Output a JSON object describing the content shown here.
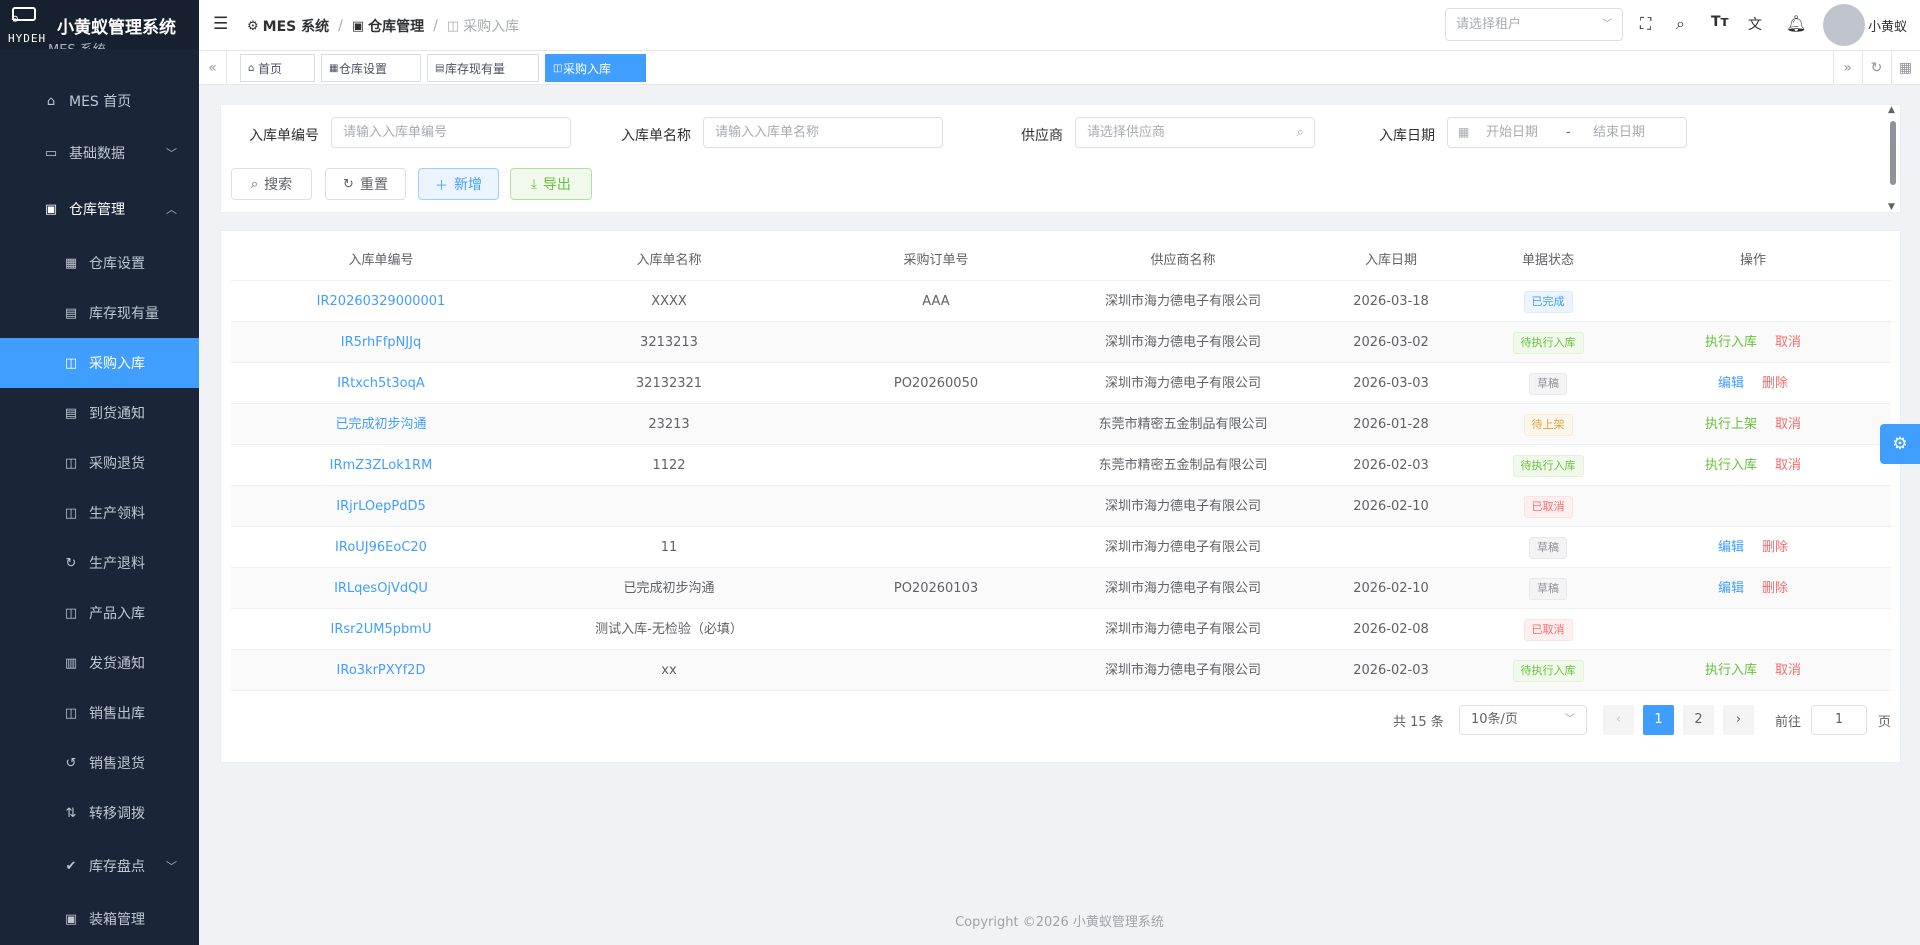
{
  "app": {
    "title": "小黄蚁管理系统",
    "logo_brand": "HYDEH",
    "logo_under": "MES 系统"
  },
  "sidebar": {
    "items": [
      {
        "label": "MES 首页",
        "icon": "home-icon"
      },
      {
        "label": "基础数据",
        "icon": "monitor-icon"
      },
      {
        "label": "仓库管理",
        "icon": "warehouse-icon"
      },
      {
        "label": "仓库设置",
        "icon": "building-icon"
      },
      {
        "label": "库存现有量",
        "icon": "document-icon"
      },
      {
        "label": "采购入库",
        "icon": "bag-icon"
      },
      {
        "label": "到货通知",
        "icon": "notice-icon"
      },
      {
        "label": "采购退货",
        "icon": "bag-icon"
      },
      {
        "label": "生产领料",
        "icon": "bag-icon"
      },
      {
        "label": "生产退料",
        "icon": "refresh-icon"
      },
      {
        "label": "产品入库",
        "icon": "bag-icon"
      },
      {
        "label": "发货通知",
        "icon": "truck-icon"
      },
      {
        "label": "销售出库",
        "icon": "bag-icon"
      },
      {
        "label": "销售退货",
        "icon": "refresh-icon"
      },
      {
        "label": "转移调拨",
        "icon": "transfer-icon"
      },
      {
        "label": "库存盘点",
        "icon": "check-circle-icon"
      },
      {
        "label": "装箱管理",
        "icon": "box-icon"
      }
    ]
  },
  "header": {
    "breadcrumb": [
      "MES 系统",
      "仓库管理",
      "采购入库"
    ],
    "tenant_placeholder": "请选择租户",
    "username": "小黄蚁"
  },
  "tabs": [
    {
      "label": "首页",
      "icon": "home-icon"
    },
    {
      "label": "仓库设置",
      "icon": "building-icon"
    },
    {
      "label": "库存现有量",
      "icon": "document-icon"
    },
    {
      "label": "采购入库",
      "icon": "bag-icon"
    }
  ],
  "search": {
    "fields": [
      {
        "label": "入库单编号",
        "placeholder": "请输入入库单编号"
      },
      {
        "label": "入库单名称",
        "placeholder": "请输入入库单名称"
      },
      {
        "label": "供应商",
        "placeholder": "请选择供应商"
      },
      {
        "label": "入库日期",
        "start": "开始日期",
        "end": "结束日期",
        "sep": "-"
      }
    ],
    "buttons": {
      "search": "搜索",
      "reset": "重置",
      "add": "新增",
      "export": "导出"
    }
  },
  "table": {
    "columns": [
      "入库单编号",
      "入库单名称",
      "采购订单号",
      "供应商名称",
      "入库日期",
      "单据状态",
      "操作"
    ],
    "rows": [
      {
        "code": "IR20260329000001",
        "name": "XXXX",
        "po": "AAA",
        "supplier": "深圳市海力德电子有限公司",
        "date": "2026-03-18",
        "status": "已完成",
        "status_color": "blue",
        "actions": []
      },
      {
        "code": "IR5rhFfpNJJq",
        "name": "3213213",
        "po": "",
        "supplier": "深圳市海力德电子有限公司",
        "date": "2026-03-02",
        "status": "待执行入库",
        "status_color": "green",
        "actions": [
          {
            "label": "执行入库",
            "color": "green"
          },
          {
            "label": "取消",
            "color": "red"
          }
        ]
      },
      {
        "code": "IRtxch5t3oqA",
        "name": "32132321",
        "po": "PO20260050",
        "supplier": "深圳市海力德电子有限公司",
        "date": "2026-03-03",
        "status": "草稿",
        "status_color": "gray",
        "actions": [
          {
            "label": "编辑",
            "color": "blue"
          },
          {
            "label": "删除",
            "color": "red"
          }
        ]
      },
      {
        "code": "已完成初步沟通",
        "name": "23213",
        "po": "",
        "supplier": "东莞市精密五金制品有限公司",
        "date": "2026-01-28",
        "status": "待上架",
        "status_color": "orange",
        "actions": [
          {
            "label": "执行上架",
            "color": "green"
          },
          {
            "label": "取消",
            "color": "red"
          }
        ]
      },
      {
        "code": "IRmZ3ZLok1RM",
        "name": "1122",
        "po": "",
        "supplier": "东莞市精密五金制品有限公司",
        "date": "2026-02-03",
        "status": "待执行入库",
        "status_color": "green",
        "actions": [
          {
            "label": "执行入库",
            "color": "green"
          },
          {
            "label": "取消",
            "color": "red"
          }
        ]
      },
      {
        "code": "IRjrLOepPdD5",
        "name": "",
        "po": "",
        "supplier": "深圳市海力德电子有限公司",
        "date": "2026-02-10",
        "status": "已取消",
        "status_color": "red",
        "actions": []
      },
      {
        "code": "IRoUJ96EoC20",
        "name": "11",
        "po": "",
        "supplier": "深圳市海力德电子有限公司",
        "date": "",
        "status": "草稿",
        "status_color": "gray",
        "actions": [
          {
            "label": "编辑",
            "color": "blue"
          },
          {
            "label": "删除",
            "color": "red"
          }
        ]
      },
      {
        "code": "IRLqesOjVdQU",
        "name": "已完成初步沟通",
        "po": "PO20260103",
        "supplier": "深圳市海力德电子有限公司",
        "date": "2026-02-10",
        "status": "草稿",
        "status_color": "gray",
        "actions": [
          {
            "label": "编辑",
            "color": "blue"
          },
          {
            "label": "删除",
            "color": "red"
          }
        ]
      },
      {
        "code": "IRsr2UM5pbmU",
        "name": "测试入库-无检验（必填）",
        "po": "",
        "supplier": "深圳市海力德电子有限公司",
        "date": "2026-02-08",
        "status": "已取消",
        "status_color": "red",
        "actions": []
      },
      {
        "code": "IRo3krPXYf2D",
        "name": "xx",
        "po": "",
        "supplier": "深圳市海力德电子有限公司",
        "date": "2026-02-03",
        "status": "待执行入库",
        "status_color": "green",
        "actions": [
          {
            "label": "执行入库",
            "color": "green"
          },
          {
            "label": "取消",
            "color": "red"
          }
        ]
      }
    ]
  },
  "pagination": {
    "total": "共 15 条",
    "page_size": "10条/页",
    "pages": [
      "1",
      "2"
    ],
    "current": "1",
    "goto_label": "前往",
    "goto_value": "1",
    "unit": "页"
  },
  "footer": "Copyright ©2026 小黄蚁管理系统",
  "colors": {
    "primary": "#409eff",
    "sidebar": "#1a2638",
    "success": "#67c23a",
    "danger": "#f56c6c",
    "warning": "#e6a23c"
  }
}
